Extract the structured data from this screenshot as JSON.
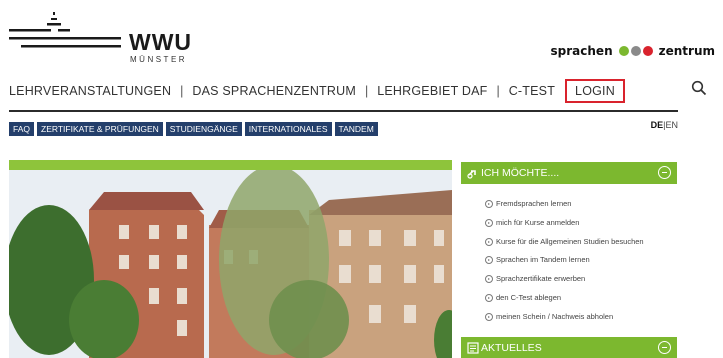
{
  "header": {
    "logo_text": "WWU",
    "logo_subtext": "MÜNSTER",
    "brand_left": "sprachen",
    "brand_right": "zentrum",
    "brand_colors": [
      "#7cb82f",
      "#8a8a8a",
      "#d9232d"
    ]
  },
  "mainnav": {
    "items": [
      "LEHRVERANSTALTUNGEN",
      "DAS SPRACHENZENTRUM",
      "LEHRGEBIET DAF",
      "C-TEST"
    ],
    "separator": "|",
    "login": "LOGIN",
    "search_icon": "search-icon"
  },
  "subnav": {
    "tags": [
      "FAQ",
      "ZERTIFIKATE & PRÜFUNGEN",
      "STUDIENGÄNGE",
      "INTERNATIONALES",
      "TANDEM"
    ]
  },
  "language": {
    "active": "DE",
    "separator": "|",
    "other": "EN"
  },
  "sidebar": {
    "ich_moechte": {
      "title": "ICH MÖCHTE....",
      "icon": "link-icon",
      "items": [
        "Fremdsprachen lernen",
        "mich für Kurse anmelden",
        "Kurse für die Allgemeinen Studien besuchen",
        "Sprachen im Tandem lernen",
        "Sprachzertifikate erwerben",
        "den C-Test ablegen",
        "meinen Schein / Nachweis abholen"
      ]
    },
    "aktuelles": {
      "title": "AKTUELLES",
      "icon": "news-icon"
    }
  },
  "colors": {
    "accent_green": "#7cb82f",
    "nav_blue": "#243f6b",
    "login_red": "#d9232d"
  }
}
